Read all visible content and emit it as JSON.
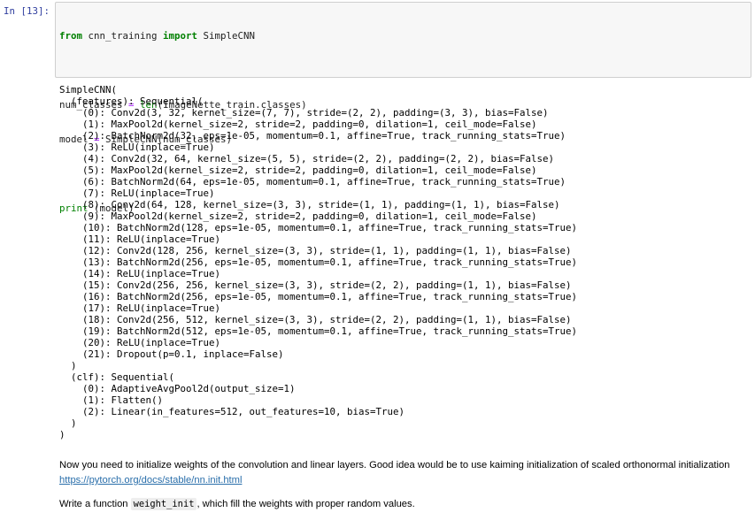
{
  "cell": {
    "prompt": "In [13]:",
    "code": {
      "line1": {
        "kw1": "from",
        "mod": " cnn_training ",
        "kw2": "import",
        "name": " SimpleCNN"
      },
      "line2": {
        "lhs": "num_classes ",
        "eq": "=",
        "sp": " ",
        "fn": "len",
        "rest": "(ImageNette_train.classes)"
      },
      "line3": {
        "lhs": "model ",
        "eq": "=",
        "rest": " SimpleCNN(num_classes)"
      },
      "line4": {
        "fn": "print",
        "rest": " (model)"
      }
    },
    "output_lines": [
      "SimpleCNN(",
      "  (features): Sequential(",
      "    (0): Conv2d(3, 32, kernel_size=(7, 7), stride=(2, 2), padding=(3, 3), bias=False)",
      "    (1): MaxPool2d(kernel_size=2, stride=2, padding=0, dilation=1, ceil_mode=False)",
      "    (2): BatchNorm2d(32, eps=1e-05, momentum=0.1, affine=True, track_running_stats=True)",
      "    (3): ReLU(inplace=True)",
      "    (4): Conv2d(32, 64, kernel_size=(5, 5), stride=(2, 2), padding=(2, 2), bias=False)",
      "    (5): MaxPool2d(kernel_size=2, stride=2, padding=0, dilation=1, ceil_mode=False)",
      "    (6): BatchNorm2d(64, eps=1e-05, momentum=0.1, affine=True, track_running_stats=True)",
      "    (7): ReLU(inplace=True)",
      "    (8): Conv2d(64, 128, kernel_size=(3, 3), stride=(1, 1), padding=(1, 1), bias=False)",
      "    (9): MaxPool2d(kernel_size=2, stride=2, padding=0, dilation=1, ceil_mode=False)",
      "    (10): BatchNorm2d(128, eps=1e-05, momentum=0.1, affine=True, track_running_stats=True)",
      "    (11): ReLU(inplace=True)",
      "    (12): Conv2d(128, 256, kernel_size=(3, 3), stride=(1, 1), padding=(1, 1), bias=False)",
      "    (13): BatchNorm2d(256, eps=1e-05, momentum=0.1, affine=True, track_running_stats=True)",
      "    (14): ReLU(inplace=True)",
      "    (15): Conv2d(256, 256, kernel_size=(3, 3), stride=(2, 2), padding=(1, 1), bias=False)",
      "    (16): BatchNorm2d(256, eps=1e-05, momentum=0.1, affine=True, track_running_stats=True)",
      "    (17): ReLU(inplace=True)",
      "    (18): Conv2d(256, 512, kernel_size=(3, 3), stride=(2, 2), padding=(1, 1), bias=False)",
      "    (19): BatchNorm2d(512, eps=1e-05, momentum=0.1, affine=True, track_running_stats=True)",
      "    (20): ReLU(inplace=True)",
      "    (21): Dropout(p=0.1, inplace=False)",
      "  )",
      "  (clf): Sequential(",
      "    (0): AdaptiveAvgPool2d(output_size=1)",
      "    (1): Flatten()",
      "    (2): Linear(in_features=512, out_features=10, bias=True)",
      "  )",
      ")"
    ]
  },
  "markdown": {
    "paragraph1": "Now you need to initialize weights of the convolution and linear layers. Good idea would be to use kaiming initialization of scaled orthonormal initialization",
    "link": "https://pytorch.org/docs/stable/nn.init.html",
    "p2_before": "Write a function ",
    "p2_code": "weight_init",
    "p2_after": ", which fill the weights with proper random values."
  },
  "colors": {
    "prompt": "#303f9f",
    "keyword": "#008000",
    "operator": "#aa22ff",
    "link": "#296eaa",
    "input_background": "#f7f7f7"
  }
}
